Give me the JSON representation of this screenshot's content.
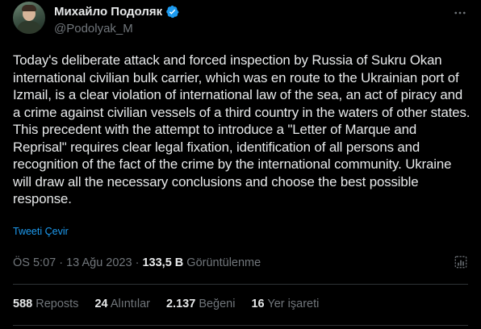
{
  "author": {
    "display_name": "Михайло Подоляк",
    "handle": "@Podolyak_M",
    "verified": true
  },
  "tweet": {
    "text": "Today's deliberate attack and forced inspection by Russia of Sukru Okan international civilian bulk carrier, which was en route to the Ukrainian port of Izmail, is a clear violation of international law of the sea, an act of piracy and a crime against civilian vessels of a third country in the waters of other states. This precedent with the attempt to introduce a \"Letter of Marque and Reprisal\" requires clear legal fixation, identification of all persons and recognition of the fact of the crime by the international community. Ukraine will draw all the necessary conclusions and choose the best possible response.",
    "translate_label": "Tweeti Çevir"
  },
  "meta": {
    "time": "ÖS 5:07",
    "separator": "·",
    "date": "13 Ağu 2023",
    "views_count": "133,5 B",
    "views_label": "Görüntülenme"
  },
  "stats": {
    "reposts_count": "588",
    "reposts_label": "Reposts",
    "quotes_count": "24",
    "quotes_label": "Alıntılar",
    "likes_count": "2.137",
    "likes_label": "Beğeni",
    "bookmarks_count": "16",
    "bookmarks_label": "Yer işareti"
  },
  "colors": {
    "background": "#000000",
    "text": "#e7e9ea",
    "secondary": "#71767b",
    "accent": "#1d9bf0",
    "divider": "#2f3336"
  },
  "icons": {
    "verified": "verified-badge-icon",
    "more": "more-icon",
    "analytics": "analytics-icon"
  }
}
